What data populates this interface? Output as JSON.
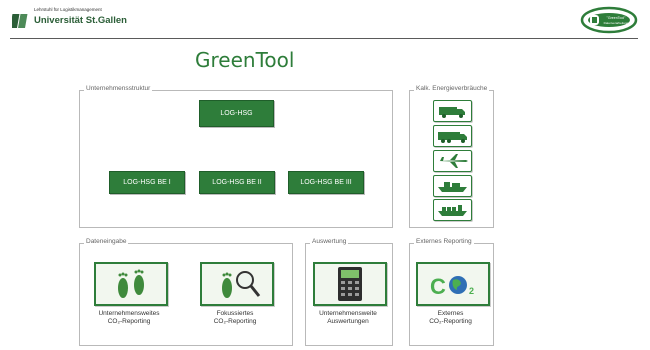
{
  "header": {
    "institute": "Lehrstuhl für Logistikmanagement",
    "university": "Universität St.Gallen",
    "badge_line1": "\"GreenTool\"",
    "badge_line2": "Datenverarbeitung"
  },
  "app_title": "GreenTool",
  "structure": {
    "legend": "Unternehmensstruktur",
    "root": "LOG-HSG",
    "units": [
      "LOG-HSG BE I",
      "LOG-HSG BE II",
      "LOG-HSG BE III"
    ]
  },
  "energy": {
    "legend": "Kalk. Energieverbräuche",
    "vehicles": [
      "truck-icon",
      "lorry-icon",
      "airplane-icon",
      "ship-icon",
      "cargo-ship-icon"
    ]
  },
  "data_input": {
    "legend": "Dateneingabe",
    "company_line1": "Unternehmensweites",
    "company_line2": "CO₂-Reporting",
    "focused_line1": "Fokussiertes",
    "focused_line2": "CO₂-Reporting"
  },
  "evaluation": {
    "legend": "Auswertung",
    "line1": "Unternehmensweite",
    "line2": "Auswertungen"
  },
  "external": {
    "legend": "Externes Reporting",
    "line1": "Externes",
    "line2": "CO₂-Reporting"
  },
  "colors": {
    "accent": "#2e7d3a",
    "border": "#b9b9b9"
  }
}
